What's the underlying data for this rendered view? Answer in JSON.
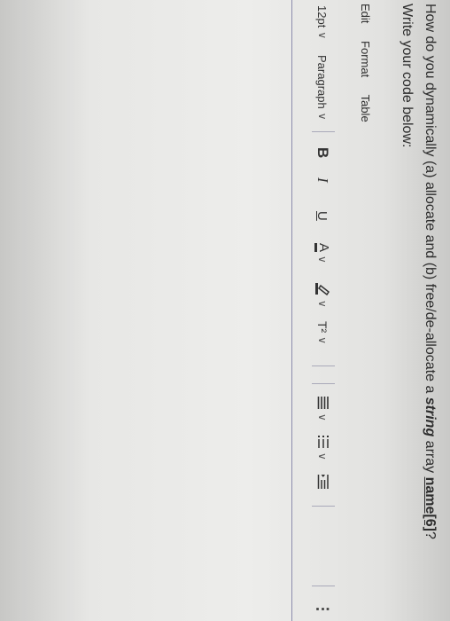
{
  "question": {
    "prefix": "How do you dynamically (a) allocate and (b) free/de-allocate a ",
    "keyword": "string",
    "middle": " array ",
    "array_name": "name[6]",
    "suffix": "?"
  },
  "subprompt": "Write your code below:",
  "menubar": {
    "edit": "Edit",
    "format": "Format",
    "table": "Table"
  },
  "toolbar": {
    "font_size": "12pt",
    "block_format": "Paragraph",
    "bold": "B",
    "italic": "I",
    "underline": "U",
    "text_color": "A",
    "highlight_icon": "highlighter-icon",
    "superscript": "T²",
    "align_icon": "align-icon",
    "list_icon": "bullet-list-icon",
    "indent_icon": "indent-icon",
    "more": "⋮"
  },
  "editor": {
    "content": ""
  }
}
